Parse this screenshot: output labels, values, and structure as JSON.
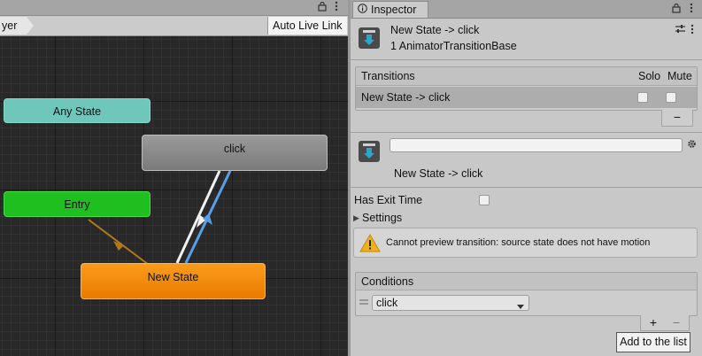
{
  "animator": {
    "breadcrumb": "yer",
    "auto_live_link": "Auto Live Link",
    "nodes": {
      "any_state": "Any State",
      "entry": "Entry",
      "click": "click",
      "new_state": "New State"
    },
    "colors": {
      "any_state": "#6fc7bb",
      "entry": "#1fbf1f",
      "state": "#8a8a8a",
      "default_state": "#f08a0b",
      "selected_transition": "#5a9ee8"
    }
  },
  "inspector": {
    "tab_label": "Inspector",
    "header": {
      "title": "New State -> click",
      "subtitle": "1 AnimatorTransitionBase"
    },
    "transitions": {
      "header": "Transitions",
      "solo_label": "Solo",
      "mute_label": "Mute",
      "rows": [
        {
          "label": "New State -> click",
          "solo": false,
          "mute": false
        }
      ],
      "remove_button": "−"
    },
    "transition_editor": {
      "name_value": "",
      "title": "New State -> click",
      "has_exit_time_label": "Has Exit Time",
      "has_exit_time": false,
      "settings_label": "Settings",
      "warning": "Cannot preview transition: source state does not have motion"
    },
    "conditions": {
      "header": "Conditions",
      "items": [
        {
          "parameter": "click"
        }
      ],
      "add_button": "+",
      "remove_button": "−"
    },
    "tooltip": "Add to the list"
  }
}
